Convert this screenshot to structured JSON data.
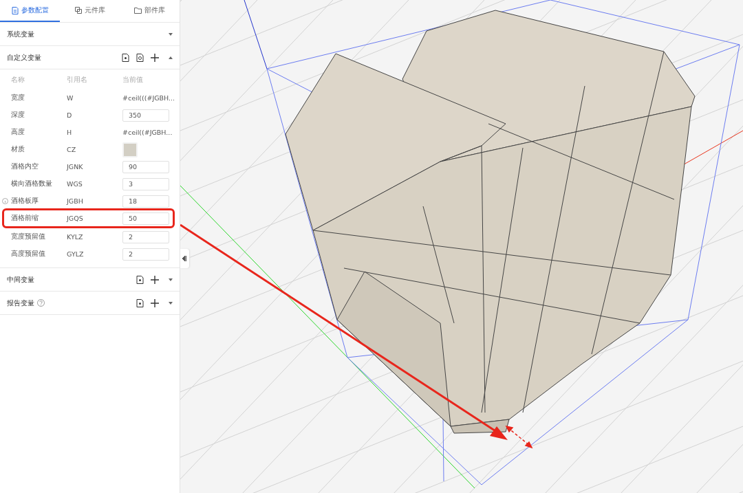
{
  "tabs": [
    {
      "label": "参数配置",
      "selected": true
    },
    {
      "label": "元件库",
      "selected": false
    },
    {
      "label": "部件库",
      "selected": false
    }
  ],
  "sections": [
    {
      "title": "系统变量",
      "help": false,
      "expanded": false
    },
    {
      "title": "自定义变量",
      "help": false,
      "expanded": true,
      "columns": [
        "名称",
        "引用名",
        "当前值"
      ],
      "rows": [
        {
          "name": "宽度",
          "ref": "W",
          "kind": "text",
          "value": "#ceil(((#JGBH...",
          "highlighted": false,
          "info": false
        },
        {
          "name": "深度",
          "ref": "D",
          "kind": "input",
          "value": "350",
          "highlighted": false,
          "info": false
        },
        {
          "name": "高度",
          "ref": "H",
          "kind": "text",
          "value": "#ceil((#JGBH...",
          "highlighted": false,
          "info": false
        },
        {
          "name": "材质",
          "ref": "CZ",
          "kind": "swatch",
          "color": "#d3cfc4",
          "highlighted": false,
          "info": false
        },
        {
          "name": "酒格内空",
          "ref": "JGNK",
          "kind": "input",
          "value": "90",
          "highlighted": false,
          "info": false
        },
        {
          "name": "横向酒格数量",
          "ref": "WGS",
          "kind": "input",
          "value": "3",
          "highlighted": false,
          "info": false
        },
        {
          "name": "酒格板厚",
          "ref": "JGBH",
          "kind": "input",
          "value": "18",
          "highlighted": false,
          "info": true
        },
        {
          "name": "酒格前缩",
          "ref": "JGQS",
          "kind": "input",
          "value": "50",
          "highlighted": true,
          "info": false
        },
        {
          "name": "宽度预留值",
          "ref": "KYLZ",
          "kind": "input",
          "value": "2",
          "highlighted": false,
          "info": false
        },
        {
          "name": "高度预留值",
          "ref": "GYLZ",
          "kind": "input",
          "value": "2",
          "highlighted": false,
          "info": false
        }
      ]
    },
    {
      "title": "中间变量",
      "help": false,
      "expanded": false
    },
    {
      "title": "报告变量",
      "help": true,
      "expanded": false
    }
  ]
}
